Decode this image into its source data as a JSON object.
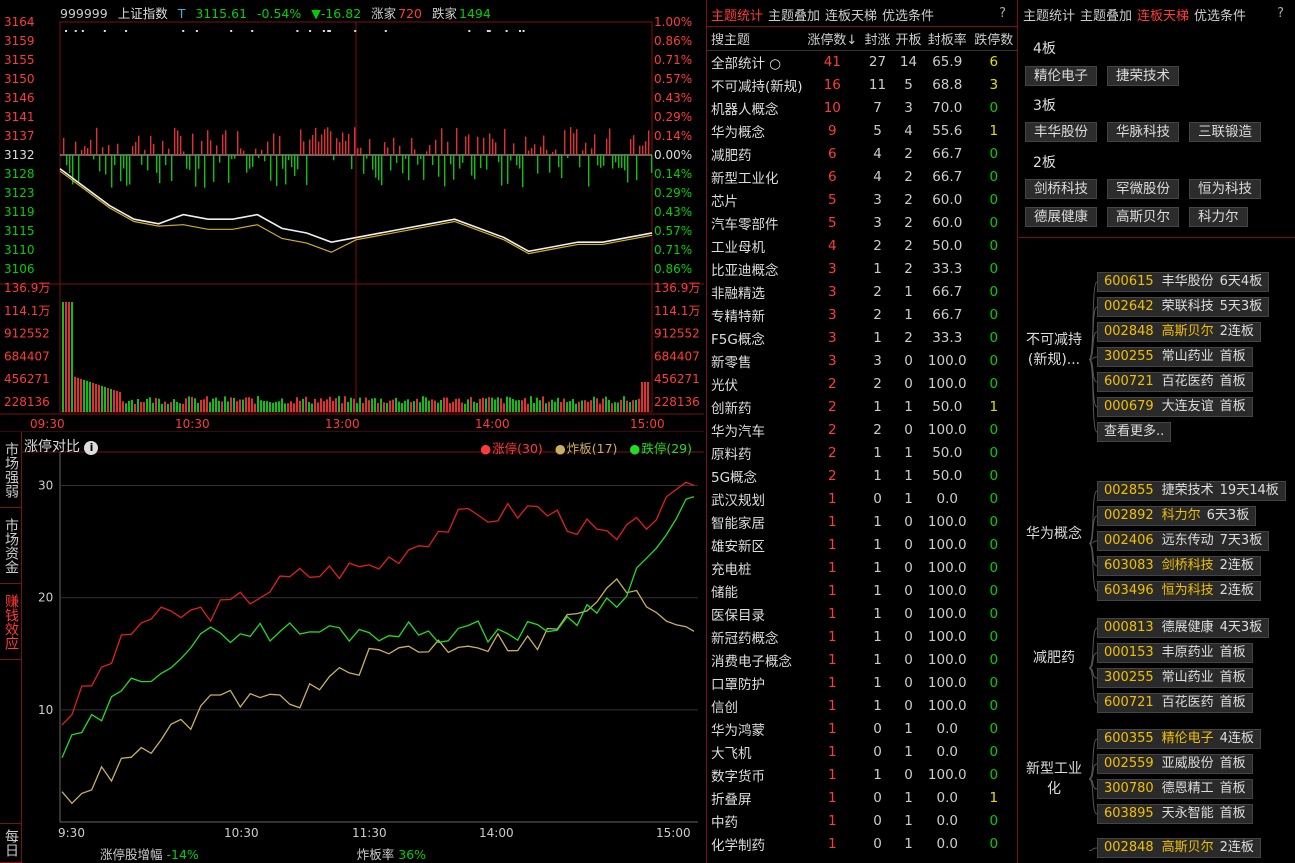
{
  "index": {
    "code": "999999",
    "name": "上证指数",
    "flag": "T",
    "price": "3115.61",
    "pct": "-0.54%",
    "chg": "▼-16.82",
    "up_label": "涨家",
    "up_count": "720",
    "down_label": "跌家",
    "down_count": "1494"
  },
  "price_axis": {
    "left": [
      "3164",
      "3159",
      "3155",
      "3150",
      "3146",
      "3141",
      "3137",
      "3132",
      "3128",
      "3123",
      "3119",
      "3115",
      "3110",
      "3106"
    ],
    "right": [
      "1.00%",
      "0.86%",
      "0.71%",
      "0.57%",
      "0.43%",
      "0.29%",
      "0.14%",
      "0.00%",
      "0.14%",
      "0.29%",
      "0.43%",
      "0.57%",
      "0.71%",
      "0.86%"
    ]
  },
  "vol_axis": {
    "left": [
      "136.9万",
      "114.1万",
      "912552",
      "684407",
      "456271",
      "228136"
    ],
    "right": [
      "136.9万",
      "114.1万",
      "912552",
      "684407",
      "456271",
      "228136"
    ]
  },
  "time_axis": [
    "09:30",
    "10:30",
    "13:00",
    "14:00",
    "15:00"
  ],
  "side_tabs": [
    "市场强弱",
    "市场资金",
    "赚钱效应",
    "每日"
  ],
  "compare": {
    "title": "涨停对比",
    "legend": [
      {
        "label": "涨停(30)",
        "color": "#ff3a3a"
      },
      {
        "label": "炸板(17)",
        "color": "#c8b060"
      },
      {
        "label": "跌停(29)",
        "color": "#22dd22"
      }
    ],
    "y_ticks": [
      "30",
      "20",
      "10"
    ],
    "x_ticks": [
      "9:30",
      "10:30",
      "11:30",
      "14:00",
      "15:00"
    ],
    "foot_label1": "涨停股增幅",
    "foot_val1": "-14%",
    "foot_label2": "炸板率",
    "foot_val2": "36%"
  },
  "mid_tabs": [
    "主题统计",
    "主题叠加",
    "连板天梯",
    "优选条件",
    "?"
  ],
  "right_tabs": [
    "主题统计",
    "主题叠加",
    "连板天梯",
    "优选条件",
    "?"
  ],
  "table": {
    "headers": [
      "搜主题",
      "涨停数↓",
      "封涨",
      "开板",
      "封板率",
      "跌停数"
    ],
    "rows": [
      [
        "全部统计 ○",
        "41",
        "27",
        "14",
        "65.9",
        "6"
      ],
      [
        "不可减持(新规)",
        "16",
        "11",
        "5",
        "68.8",
        "3"
      ],
      [
        "机器人概念",
        "10",
        "7",
        "3",
        "70.0",
        "0"
      ],
      [
        "华为概念",
        "9",
        "5",
        "4",
        "55.6",
        "1"
      ],
      [
        "减肥药",
        "6",
        "4",
        "2",
        "66.7",
        "0"
      ],
      [
        "新型工业化",
        "6",
        "4",
        "2",
        "66.7",
        "0"
      ],
      [
        "芯片",
        "5",
        "3",
        "2",
        "60.0",
        "0"
      ],
      [
        "汽车零部件",
        "5",
        "3",
        "2",
        "60.0",
        "0"
      ],
      [
        "工业母机",
        "4",
        "2",
        "2",
        "50.0",
        "0"
      ],
      [
        "比亚迪概念",
        "3",
        "1",
        "2",
        "33.3",
        "0"
      ],
      [
        "非融精选",
        "3",
        "2",
        "1",
        "66.7",
        "0"
      ],
      [
        "专精特新",
        "3",
        "2",
        "1",
        "66.7",
        "0"
      ],
      [
        "F5G概念",
        "3",
        "1",
        "2",
        "33.3",
        "0"
      ],
      [
        "新零售",
        "3",
        "3",
        "0",
        "100.0",
        "0"
      ],
      [
        "光伏",
        "2",
        "2",
        "0",
        "100.0",
        "0"
      ],
      [
        "创新药",
        "2",
        "1",
        "1",
        "50.0",
        "1"
      ],
      [
        "华为汽车",
        "2",
        "2",
        "0",
        "100.0",
        "0"
      ],
      [
        "原料药",
        "2",
        "1",
        "1",
        "50.0",
        "0"
      ],
      [
        "5G概念",
        "2",
        "1",
        "1",
        "50.0",
        "0"
      ],
      [
        "武汉规划",
        "1",
        "0",
        "1",
        "0.0",
        "0"
      ],
      [
        "智能家居",
        "1",
        "1",
        "0",
        "100.0",
        "0"
      ],
      [
        "雄安新区",
        "1",
        "1",
        "0",
        "100.0",
        "0"
      ],
      [
        "充电桩",
        "1",
        "1",
        "0",
        "100.0",
        "0"
      ],
      [
        "储能",
        "1",
        "1",
        "0",
        "100.0",
        "0"
      ],
      [
        "医保目录",
        "1",
        "1",
        "0",
        "100.0",
        "0"
      ],
      [
        "新冠药概念",
        "1",
        "1",
        "0",
        "100.0",
        "0"
      ],
      [
        "消费电子概念",
        "1",
        "1",
        "0",
        "100.0",
        "0"
      ],
      [
        "口罩防护",
        "1",
        "1",
        "0",
        "100.0",
        "0"
      ],
      [
        "信创",
        "1",
        "1",
        "0",
        "100.0",
        "0"
      ],
      [
        "华为鸿蒙",
        "1",
        "0",
        "1",
        "0.0",
        "0"
      ],
      [
        "大飞机",
        "1",
        "0",
        "1",
        "0.0",
        "0"
      ],
      [
        "数字货币",
        "1",
        "1",
        "0",
        "100.0",
        "0"
      ],
      [
        "折叠屏",
        "1",
        "0",
        "1",
        "0.0",
        "1"
      ],
      [
        "中药",
        "1",
        "0",
        "1",
        "0.0",
        "0"
      ],
      [
        "化学制药",
        "1",
        "0",
        "1",
        "0.0",
        "0"
      ]
    ]
  },
  "ladder": [
    {
      "level": "4板",
      "stocks": [
        "精伦电子",
        "捷荣技术"
      ]
    },
    {
      "level": "3板",
      "stocks": [
        "丰华股份",
        "华脉科技",
        "三联锻造"
      ]
    },
    {
      "level": "2板",
      "stocks": [
        "剑桥科技",
        "罕微股份",
        "恒为科技",
        "德展健康",
        "高斯贝尔",
        "科力尔"
      ]
    }
  ],
  "groups": [
    {
      "name": "不可减持(新规)...",
      "stocks": [
        {
          "code": "600615",
          "name": "丰华股份",
          "board": "6天4板",
          "hl": false
        },
        {
          "code": "002642",
          "name": "荣联科技",
          "board": "5天3板",
          "hl": false
        },
        {
          "code": "002848",
          "name": "高斯贝尔",
          "board": "2连板",
          "hl": true
        },
        {
          "code": "300255",
          "name": "常山药业",
          "board": "首板",
          "hl": false
        },
        {
          "code": "600721",
          "name": "百花医药",
          "board": "首板",
          "hl": false
        },
        {
          "code": "000679",
          "name": "大连友谊",
          "board": "首板",
          "hl": false
        }
      ],
      "more": "查看更多.."
    },
    {
      "name": "华为概念",
      "stocks": [
        {
          "code": "002855",
          "name": "捷荣技术",
          "board": "19天14板",
          "hl": false
        },
        {
          "code": "002892",
          "name": "科力尔",
          "board": "6天3板",
          "hl": true
        },
        {
          "code": "002406",
          "name": "远东传动",
          "board": "7天3板",
          "hl": false
        },
        {
          "code": "603083",
          "name": "剑桥科技",
          "board": "2连板",
          "hl": true
        },
        {
          "code": "603496",
          "name": "恒为科技",
          "board": "2连板",
          "hl": true
        }
      ]
    },
    {
      "name": "减肥药",
      "stocks": [
        {
          "code": "000813",
          "name": "德展健康",
          "board": "4天3板",
          "hl": false
        },
        {
          "code": "000153",
          "name": "丰原药业",
          "board": "首板",
          "hl": false
        },
        {
          "code": "300255",
          "name": "常山药业",
          "board": "首板",
          "hl": false
        },
        {
          "code": "600721",
          "name": "百花医药",
          "board": "首板",
          "hl": false
        }
      ]
    },
    {
      "name": "新型工业化",
      "stocks": [
        {
          "code": "600355",
          "name": "精伦电子",
          "board": "4连板",
          "hl": true
        },
        {
          "code": "002559",
          "name": "亚威股份",
          "board": "首板",
          "hl": false
        },
        {
          "code": "300780",
          "name": "德恩精工",
          "board": "首板",
          "hl": false
        },
        {
          "code": "603895",
          "name": "天永智能",
          "board": "首板",
          "hl": false
        }
      ]
    },
    {
      "name": "",
      "stocks": [
        {
          "code": "002848",
          "name": "高斯贝尔",
          "board": "2连板",
          "hl": true
        }
      ]
    }
  ],
  "chart_data": [
    {
      "type": "line",
      "title": "",
      "series": [
        {
          "name": "上证指数",
          "values": [
            3132,
            3128,
            3124,
            3121,
            3120,
            3122,
            3121,
            3121,
            3122,
            3119,
            3118,
            3116,
            3117,
            3118,
            3119,
            3120,
            3121,
            3119,
            3117,
            3114,
            3115,
            3116,
            3116,
            3117,
            3118
          ]
        }
      ],
      "ylim": [
        3106,
        3164
      ],
      "xlabel": "",
      "ylabel": ""
    },
    {
      "type": "line",
      "title": "涨停对比",
      "x": [
        "9:30",
        "10:00",
        "10:30",
        "11:00",
        "11:30",
        "13:30",
        "14:00",
        "14:30",
        "15:00"
      ],
      "series": [
        {
          "name": "涨停(30)",
          "values": [
            9,
            18,
            19,
            22,
            23,
            27,
            28,
            25,
            30
          ]
        },
        {
          "name": "炸板(17)",
          "values": [
            2,
            6,
            11,
            11,
            15,
            16,
            16,
            21,
            17
          ]
        },
        {
          "name": "跌停(29)",
          "values": [
            6,
            13,
            17,
            17,
            17,
            17,
            17,
            20,
            29
          ]
        }
      ],
      "ylim": [
        0,
        32
      ]
    }
  ]
}
